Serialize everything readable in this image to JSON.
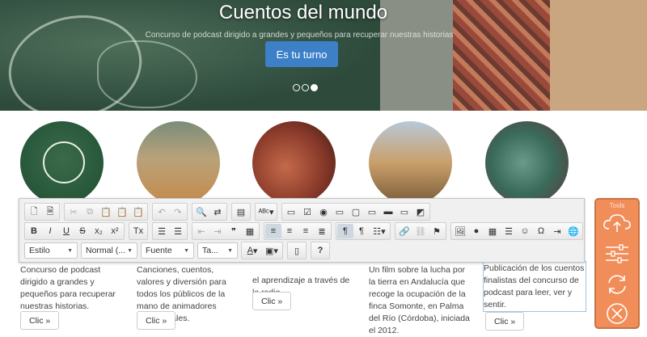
{
  "hero": {
    "title": "Cuentos del mundo",
    "subtitle": "Concurso de podcast dirigido a grandes y pequeños para recuperar nuestras historias",
    "cta": "Es tu turno",
    "slides": 3,
    "active_slide": 2
  },
  "columns": [
    {
      "text": "Concurso de podcast dirigido a grandes y pequeños para recuperar nuestras historias.",
      "button": "Clic »"
    },
    {
      "text": "Canciones, cuentos, valores y diversión para todos los públicos de la mano de animadores profesionales.",
      "button": "Clic »"
    },
    {
      "text": "el aprendizaje a través de la radio.",
      "button": "Clic »"
    },
    {
      "text": "Un film sobre la lucha por la tierra en Andalucía que recoge la ocupación de la finca Somonte, en Palma del Río (Córdoba), iniciada el 2012.",
      "button": "Clic »"
    },
    {
      "text": "Publicación de los cuentos finalistas del concurso de podcast para leer, ver y sentir.",
      "button": "Clic »"
    }
  ],
  "toolbar": {
    "combos": {
      "style": "Estilo",
      "format": "Normal (...",
      "font": "Fuente",
      "size": "Ta..."
    },
    "glyphs": {
      "bold": "B",
      "italic": "I",
      "underline": "U",
      "strike": "S",
      "subscript": "x₂",
      "superscript": "x²",
      "remove_format": "Tx",
      "quote": "❞",
      "help": "?",
      "ltr": "¶",
      "rtl": "¶",
      "omega": "Ω",
      "smiley": "☺"
    }
  },
  "tools_panel": {
    "title": "Tools",
    "accent": "#f18d58"
  },
  "colors": {
    "hero_button": "#3d80c8",
    "editable_outline": "#9ec3e6"
  }
}
